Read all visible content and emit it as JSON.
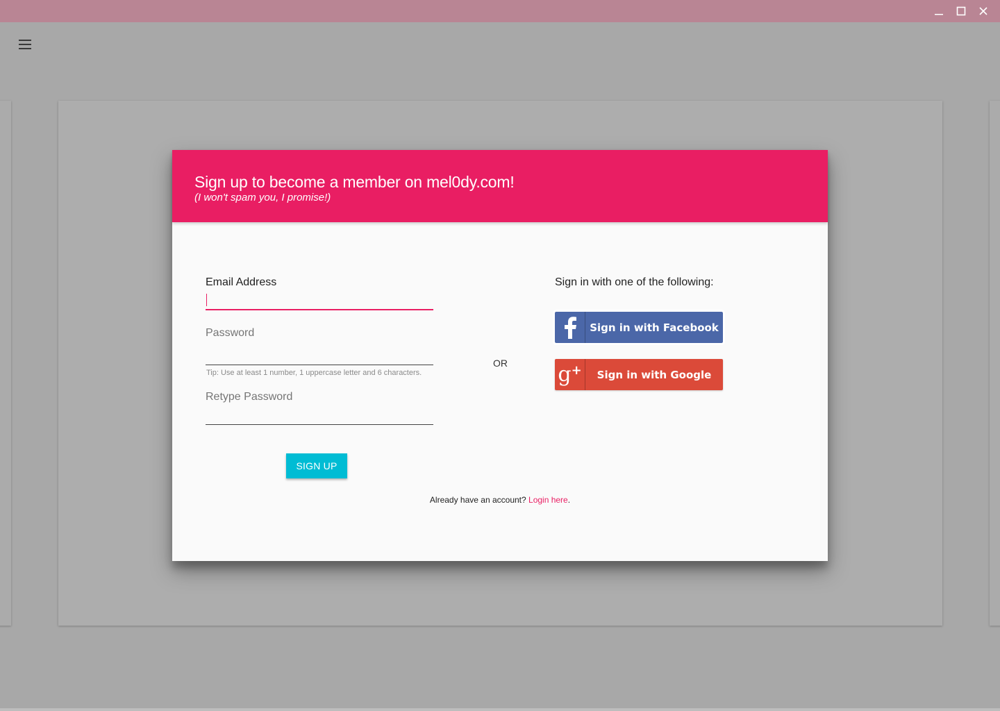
{
  "window": {
    "controls": [
      "minimize-icon",
      "maximize-icon",
      "close-icon"
    ]
  },
  "dialog": {
    "title": "Sign up to become a member on mel0dy.com!",
    "subtitle": "(I won't spam you, I promise!)",
    "accent_color": "#e91e63"
  },
  "form": {
    "email_label": "Email Address",
    "email_value": "",
    "password_label": "Password",
    "password_hint": "Tip: Use at least 1 number, 1 uppercase letter and 6 characters.",
    "retype_label": "Retype Password",
    "signup_label": "SIGN UP"
  },
  "divider": {
    "or_label": "OR"
  },
  "social": {
    "heading": "Sign in with one of the following:",
    "facebook_label": "Sign in with Facebook",
    "google_label": "Sign in with Google",
    "facebook_color": "#4b67a8",
    "google_color": "#db4a39"
  },
  "footer": {
    "prompt": "Already have an account? ",
    "link": "Login here",
    "suffix": "."
  }
}
